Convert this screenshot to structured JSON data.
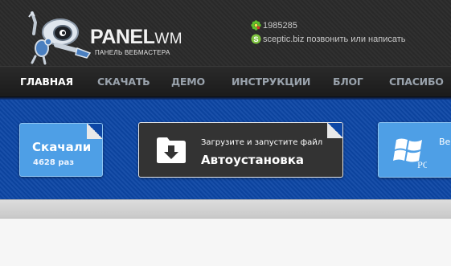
{
  "logo": {
    "word_bold": "PANEL",
    "word_light": "WM",
    "subtitle": "ПАНЕЛЬ ВЕБМАСТЕРА",
    "icon": "robot-mascot-icon"
  },
  "contacts": {
    "icq_icon": "icq-flower-icon",
    "icq_number": "1985285",
    "skype_icon": "skype-icon",
    "skype_text": "sceptic.biz позвонить или написать"
  },
  "nav": {
    "items": [
      {
        "label": "ГЛАВНАЯ",
        "active": true
      },
      {
        "label": "СКАЧАТЬ",
        "active": false
      },
      {
        "label": "ДЕМО",
        "active": false
      },
      {
        "label": "ИНСТРУКЦИИ",
        "active": false
      },
      {
        "label": "БЛОГ",
        "active": false
      },
      {
        "label": "СПАСИБО",
        "active": false
      }
    ]
  },
  "tiles": {
    "downloads": {
      "title": "Скачали",
      "subtitle": "4628 раз"
    },
    "autoinstall": {
      "small": "Загрузите и запустите файл",
      "big": "Автоустановка",
      "icon": "folder-download-icon"
    },
    "windows": {
      "text": "Ве",
      "icon": "windows-pc-icon",
      "icon_label": "PC"
    }
  },
  "colors": {
    "header_bg": "#2b2b2b",
    "band_bg": "#0d47a6",
    "tile_blue": "#4e9fe6",
    "tile_dark": "#333333",
    "nav_active": "#ffffff",
    "nav_inactive": "#9aa3ad"
  }
}
